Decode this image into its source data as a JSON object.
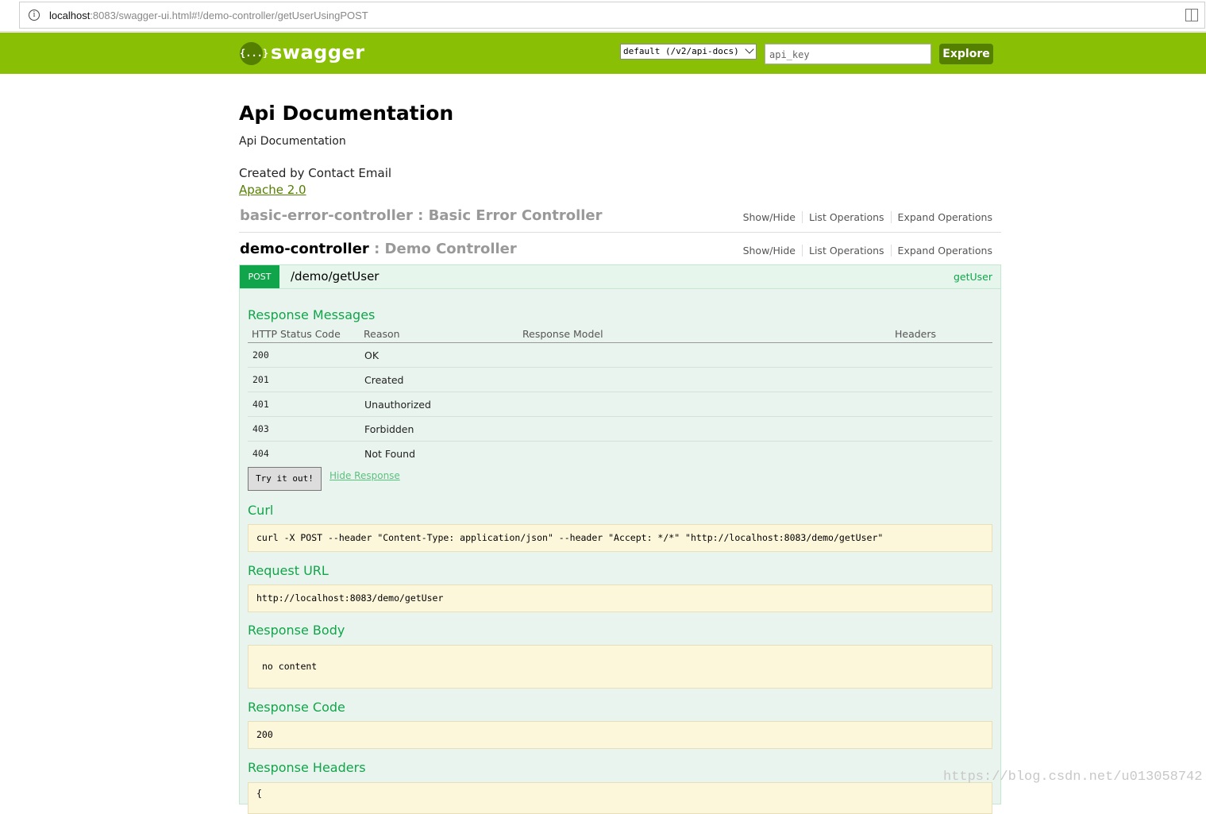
{
  "browser": {
    "url_host": "localhost",
    "url_rest": ":8083/swagger-ui.html#!/demo-controller/getUserUsingPOST"
  },
  "header": {
    "logo_glyph": "{...}",
    "logo_text": "swagger",
    "spec_select": "default (/v2/api-docs)",
    "api_key_placeholder": "api_key",
    "explore_label": "Explore",
    "bar_color": "#89bf04"
  },
  "info": {
    "title": "Api Documentation",
    "description": "Api Documentation",
    "created": "Created by Contact Email",
    "license": "Apache 2.0"
  },
  "controllers": [
    {
      "name": "basic-error-controller",
      "desc": " : Basic Error Controller",
      "ops": [
        "Show/Hide",
        "List Operations",
        "Expand Operations"
      ]
    },
    {
      "name": "demo-controller",
      "desc": " : Demo Controller",
      "ops": [
        "Show/Hide",
        "List Operations",
        "Expand Operations"
      ]
    }
  ],
  "operation": {
    "method": "POST",
    "path": "/demo/getUser",
    "nickname": "getUser",
    "response_messages_title": "Response Messages",
    "columns": [
      "HTTP Status Code",
      "Reason",
      "Response Model",
      "Headers"
    ],
    "rows": [
      {
        "code": "200",
        "reason": "OK"
      },
      {
        "code": "201",
        "reason": "Created"
      },
      {
        "code": "401",
        "reason": "Unauthorized"
      },
      {
        "code": "403",
        "reason": "Forbidden"
      },
      {
        "code": "404",
        "reason": "Not Found"
      }
    ],
    "try_label": "Try it out!",
    "hide_response": "Hide Response",
    "curl_title": "Curl",
    "curl": "curl -X POST --header \"Content-Type: application/json\" --header \"Accept: */*\" \"http://localhost:8083/demo/getUser\"",
    "request_url_title": "Request URL",
    "request_url": "http://localhost:8083/demo/getUser",
    "response_body_title": "Response Body",
    "response_body": "no content",
    "response_code_title": "Response Code",
    "response_code": "200",
    "response_headers_title": "Response Headers",
    "response_headers": "{"
  },
  "watermark": "https://blog.csdn.net/u013058742"
}
